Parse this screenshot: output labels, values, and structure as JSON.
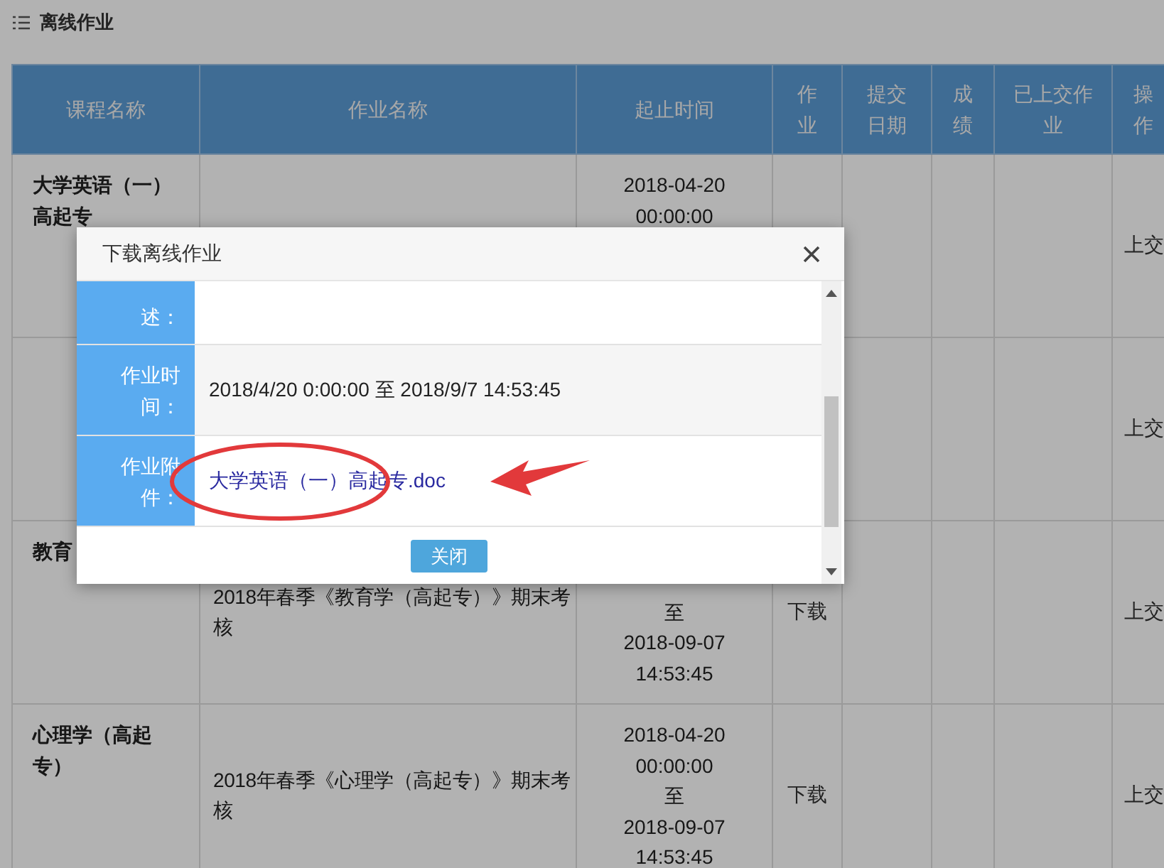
{
  "page_title": "离线作业",
  "table": {
    "columns": [
      "课程名称",
      "作业名称",
      "起止时间",
      "作业",
      "提交日期",
      "成绩",
      "已上交作业",
      "操作"
    ],
    "rows": [
      {
        "course": "大学英语（一）高起专",
        "time_lines": [
          "2018-04-20",
          "00:00:00"
        ],
        "action": "上交"
      },
      {
        "action": "上交"
      },
      {
        "course": "教育",
        "name": "2018年春季《教育学（高起专）》期末考核",
        "time_lines": [
          "至",
          "2018-09-07",
          "14:53:45"
        ],
        "download": "下载",
        "action": "上交"
      },
      {
        "course": "心理学（高起专）",
        "name": "2018年春季《心理学（高起专）》期末考核",
        "time_lines": [
          "2018-04-20",
          "00:00:00",
          "至",
          "2018-09-07",
          "14:53:45"
        ],
        "download": "下载",
        "action": "上交"
      }
    ]
  },
  "dialog": {
    "title": "下载离线作业",
    "fields": [
      {
        "kind": "text",
        "label": "述："
      },
      {
        "kind": "text",
        "label": "作业时间：",
        "value": "2018/4/20 0:00:00 至 2018/9/7 14:53:45"
      },
      {
        "kind": "link",
        "label": "作业附件：",
        "value": "大学英语（一）高起专.doc"
      }
    ],
    "close_button": "关闭"
  }
}
